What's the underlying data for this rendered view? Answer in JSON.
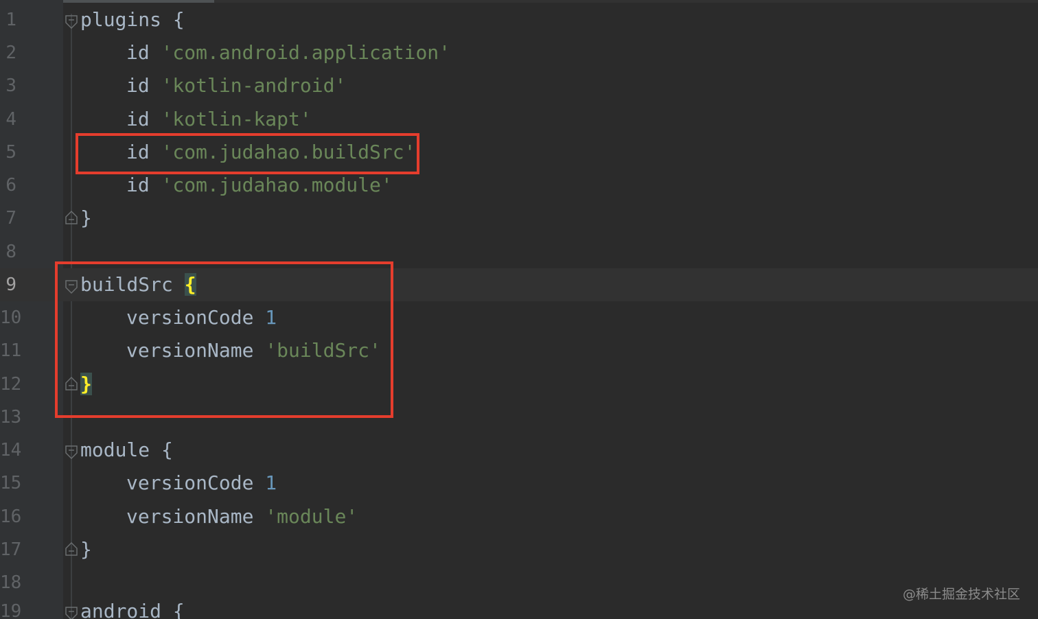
{
  "editor": {
    "lines": [
      {
        "num": "1",
        "tokens": [
          "plugins",
          "{"
        ]
      },
      {
        "num": "2",
        "tokens": [
          "id",
          "'com.android.application'"
        ]
      },
      {
        "num": "3",
        "tokens": [
          "id",
          "'kotlin-android'"
        ]
      },
      {
        "num": "4",
        "tokens": [
          "id",
          "'kotlin-kapt'"
        ]
      },
      {
        "num": "5",
        "tokens": [
          "id",
          "'com.judahao.buildSrc'"
        ]
      },
      {
        "num": "6",
        "tokens": [
          "id",
          "'com.judahao.module'"
        ]
      },
      {
        "num": "7",
        "tokens": [
          "}"
        ]
      },
      {
        "num": "8",
        "tokens": []
      },
      {
        "num": "9",
        "tokens": [
          "buildSrc",
          "{"
        ]
      },
      {
        "num": "10",
        "tokens": [
          "versionCode",
          "1"
        ]
      },
      {
        "num": "11",
        "tokens": [
          "versionName",
          "'buildSrc'"
        ]
      },
      {
        "num": "12",
        "tokens": [
          "}"
        ]
      },
      {
        "num": "13",
        "tokens": []
      },
      {
        "num": "14",
        "tokens": [
          "module",
          "{"
        ]
      },
      {
        "num": "15",
        "tokens": [
          "versionCode",
          "1"
        ]
      },
      {
        "num": "16",
        "tokens": [
          "versionName",
          "'module'"
        ]
      },
      {
        "num": "17",
        "tokens": [
          "}"
        ]
      },
      {
        "num": "18",
        "tokens": []
      },
      {
        "num": "19",
        "tokens": [
          "android",
          "{"
        ]
      }
    ],
    "current_line": "9"
  },
  "colors": {
    "background": "#2b2b2b",
    "gutter": "#313335",
    "identifier": "#a9b7c6",
    "string": "#6a8759",
    "number": "#6897bb",
    "brace_match": "#ffef28",
    "annotation_box": "#e53d2d"
  },
  "icons": {
    "fold_open": "fold-open-icon",
    "fold_close": "fold-close-icon"
  },
  "watermark": "@稀土掘金技术社区"
}
